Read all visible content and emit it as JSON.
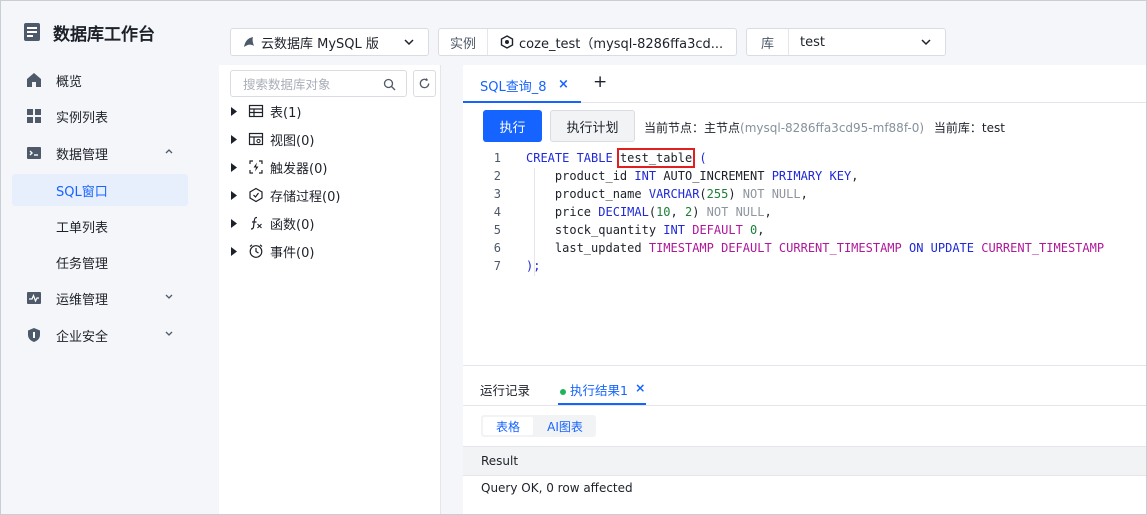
{
  "app": {
    "title": "数据库工作台"
  },
  "sidebar": {
    "items": [
      {
        "label": "概览",
        "icon": "home-icon"
      },
      {
        "label": "实例列表",
        "icon": "grid-icon"
      },
      {
        "label": "数据管理",
        "icon": "database-icon"
      },
      {
        "label": "SQL窗口",
        "icon": ""
      },
      {
        "label": "工单列表",
        "icon": ""
      },
      {
        "label": "任务管理",
        "icon": ""
      },
      {
        "label": "运维管理",
        "icon": "monitor-icon"
      },
      {
        "label": "企业安全",
        "icon": "shield-icon"
      }
    ],
    "active": "SQL窗口"
  },
  "toolbar": {
    "engine": "云数据库 MySQL 版",
    "instance_prefix": "实例",
    "instance_value": "coze_test（mysql-8286ffa3cd...",
    "db_prefix": "库",
    "db_value": "test"
  },
  "objects": {
    "search_placeholder": "搜索数据库对象",
    "tree": [
      {
        "label": "表(1)",
        "icon": "table-icon"
      },
      {
        "label": "视图(0)",
        "icon": "view-icon"
      },
      {
        "label": "触发器(0)",
        "icon": "trigger-icon"
      },
      {
        "label": "存储过程(0)",
        "icon": "procedure-icon"
      },
      {
        "label": "函数(0)",
        "icon": "function-icon"
      },
      {
        "label": "事件(0)",
        "icon": "clock-icon"
      }
    ]
  },
  "editor": {
    "tab_label": "SQL查询_8",
    "tab_close": "×",
    "add_tab": "+",
    "run_label": "执行",
    "plan_label": "执行计划",
    "node_prefix": "当前节点：主节点",
    "node_value": "(mysql-8286ffa3cd95-mf88f-0)",
    "db_prefix": "当前库：",
    "db_value": "test",
    "line_numbers": [
      "1",
      "2",
      "3",
      "4",
      "5",
      "6",
      "7"
    ],
    "code": {
      "l1_kw": "CREATE TABLE",
      "l1_name": "test_table",
      "l1_paren": "(",
      "l2_col": "product_id",
      "l2_type": "INT",
      "l2_rest": "AUTO_INCREMENT",
      "l2_kw": "PRIMARY KEY",
      "l3_col": "product_name",
      "l3_type": "VARCHAR",
      "l3_num": "255",
      "l3_null": "NOT NULL",
      "l4_col": "price",
      "l4_type": "DECIMAL",
      "l4_num1": "10",
      "l4_num2": "2",
      "l4_null": "NOT NULL",
      "l5_col": "stock_quantity",
      "l5_type": "INT",
      "l5_kw": "DEFAULT",
      "l5_num": "0",
      "l6_col": "last_updated",
      "l6_type": "TIMESTAMP",
      "l6_kw": "DEFAULT",
      "l6_fn": "CURRENT_TIMESTAMP",
      "l6_kw2": "ON UPDATE",
      "l6_fn2": "CURRENT_TIMESTAMP",
      "l7": ");"
    }
  },
  "results": {
    "tab_history": "运行记录",
    "tab_result": "执行结果1",
    "tab_close": "×",
    "view_table": "表格",
    "view_ai": "AI图表",
    "column": "Result",
    "row": "Query OK, 0 row affected"
  },
  "colors": {
    "accent": "#1664ff",
    "highlight_box": "#e02020",
    "status_dot": "#22b35e"
  }
}
